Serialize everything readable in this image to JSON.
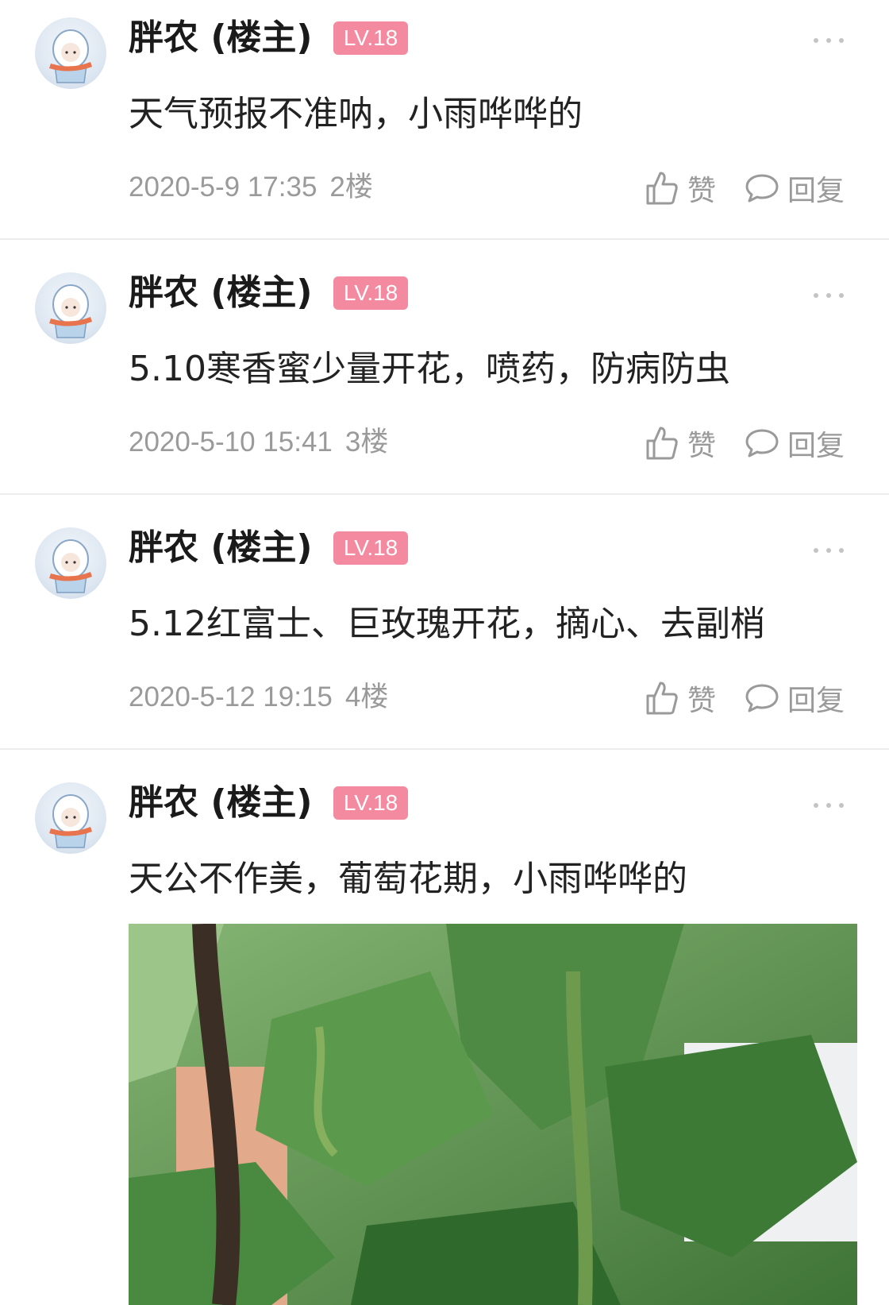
{
  "posts": [
    {
      "author": "胖农 (楼主)",
      "level": "LV.18",
      "content": "天气预报不准呐，小雨哗哗的",
      "time": "2020-5-9 17:35",
      "floor": "2楼",
      "like_label": "赞",
      "reply_label": "回复"
    },
    {
      "author": "胖农 (楼主)",
      "level": "LV.18",
      "content": "5.10寒香蜜少量开花，喷药，防病防虫",
      "time": "2020-5-10 15:41",
      "floor": "3楼",
      "like_label": "赞",
      "reply_label": "回复"
    },
    {
      "author": "胖农 (楼主)",
      "level": "LV.18",
      "content": "5.12红富士、巨玫瑰开花，摘心、去副梢",
      "time": "2020-5-12 19:15",
      "floor": "4楼",
      "like_label": "赞",
      "reply_label": "回复"
    },
    {
      "author": "胖农 (楼主)",
      "level": "LV.18",
      "content": "天公不作美，葡萄花期，小雨哗哗的"
    }
  ],
  "colors": {
    "badge": "#f48aa0",
    "meta_text": "#9a9a9a",
    "divider": "#ececec"
  },
  "icons": [
    "more-icon",
    "thumbs-up-icon",
    "comment-icon"
  ]
}
